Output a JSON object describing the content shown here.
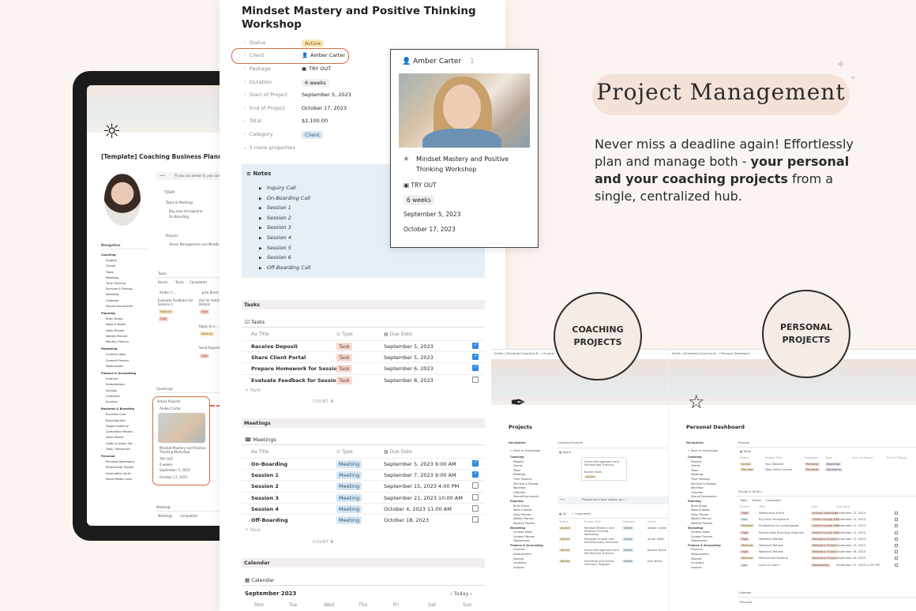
{
  "hero": {
    "badge": "Project Management",
    "description_pre": "Never miss a deadline again! Effortlessly plan and manage both - ",
    "description_bold": "your personal and your coaching projects",
    "description_post": " from a single, centralized hub."
  },
  "circles": {
    "coaching": "COACHING\nPROJECTS",
    "personal": "PERSONAL\nPROJECTS"
  },
  "page": {
    "title": "Mindset Mastery and Positive Thinking Workshop",
    "properties": [
      {
        "label": "Status",
        "value": "Active",
        "icon": "sun-icon"
      },
      {
        "label": "Client",
        "value": "Amber Carter",
        "icon": "user-icon"
      },
      {
        "label": "Package",
        "value": "TRY OUT",
        "icon": "package-icon"
      },
      {
        "label": "Duration",
        "value": "6 weeks",
        "icon": "clock-icon"
      },
      {
        "label": "Start of Project",
        "value": "September 5, 2023",
        "icon": "calendar-icon"
      },
      {
        "label": "End of Project",
        "value": "October 17, 2023",
        "icon": "calendar-icon"
      },
      {
        "label": "Total",
        "value": "$2,100.00",
        "icon": "sum-icon"
      },
      {
        "label": "Category",
        "value": "Client",
        "icon": "tag-icon"
      }
    ],
    "more_properties": "5 more properties",
    "notes": {
      "title": "Notes",
      "items": [
        "Inquiry Call",
        "On-Boarding Call",
        "Session 1",
        "Session 2",
        "Session 3",
        "Session 4",
        "Session 5",
        "Session 6",
        "Off-Boarding Call"
      ]
    },
    "tasks": {
      "section": "Tasks",
      "db_title": "Tasks",
      "headers": [
        "Aa Title",
        "Type",
        "Due Date"
      ],
      "rows": [
        {
          "title": "Receive Deposit",
          "type": "Task",
          "date": "September 5, 2023",
          "done": true
        },
        {
          "title": "Share Client Portal",
          "type": "Task",
          "date": "September 5, 2023",
          "done": true
        },
        {
          "title": "Prepare Homework for Session 1",
          "type": "Task",
          "date": "September 6, 2023",
          "done": true
        },
        {
          "title": "Evaluate Feedback for Session 1",
          "type": "Task",
          "date": "September 8, 2023",
          "done": false
        }
      ],
      "new_label": "+ New",
      "count_label": "COUNT",
      "count": "4"
    },
    "meetings": {
      "section": "Meetings",
      "db_title": "Meetings",
      "headers": [
        "Aa Title",
        "Type",
        "Due Date"
      ],
      "rows": [
        {
          "title": "On-Boarding",
          "type": "Meeting",
          "date": "September 5, 2023 9:00 AM",
          "done": true
        },
        {
          "title": "Session 1",
          "type": "Meeting",
          "date": "September 7, 2023 9:00 AM",
          "done": true
        },
        {
          "title": "Session 2",
          "type": "Meeting",
          "date": "September 15, 2023 4:00 PM",
          "done": false
        },
        {
          "title": "Session 3",
          "type": "Meeting",
          "date": "September 21, 2023 10:00 AM",
          "done": false
        },
        {
          "title": "Session 4",
          "type": "Meeting",
          "date": "October 4, 2023 11:00 AM",
          "done": false
        },
        {
          "title": "Off-Boarding",
          "type": "Meeting",
          "date": "October 18, 2023",
          "done": false
        }
      ],
      "new_label": "+ New",
      "count_label": "COUNT",
      "count": "6"
    },
    "calendar": {
      "section": "Calendar",
      "db_title": "Calendar",
      "month": "September 2023",
      "today": "Today",
      "days": [
        "Mon",
        "Tue",
        "Wed",
        "Thu",
        "Fri",
        "Sat",
        "Sun"
      ]
    }
  },
  "popup": {
    "name": "Amber Carter",
    "count": "1",
    "project": "Mindset Mastery and Positive Thinking Workshop",
    "package": "TRY OUT",
    "duration": "6 weeks",
    "start": "September 5, 2023",
    "end": "October 17, 2023"
  },
  "tablet": {
    "title": "[Template] Coaching Business Planner",
    "quote": "\"If you can dream it, you can...",
    "today": "TODAY",
    "tasks_meetings": "Tasks & Meetings",
    "todo1": "Buy new microphone",
    "todo2": "On-Boarding",
    "projects": "Projects",
    "project1": "Stress Management and Mindfu...",
    "nav_title": "Navigation",
    "nav": [
      "Coaching",
      "Projects",
      "Clients",
      "Tasks",
      "Meetings",
      "Time Tracking",
      "Services & Packag...",
      "Workflow",
      "Calendar",
      "Shared Documents",
      "Planning",
      "Brain Dump",
      "Ideas & Notes",
      "Daily Planner",
      "Weekly Planner",
      "Monthly Planner",
      "Marketing",
      "Content Ideas",
      "Content Planner",
      "Testimonials",
      "Finance & Accounting",
      "Finances",
      "Subscriptions",
      "Savings",
      "Contracts",
      "Invoices",
      "Business & Branding",
      "Business Core",
      "Branding Hub",
      "Target Audience",
      "Competitor Resear...",
      "Vision Board",
      "Goals & Action Ste...",
      "Tools / Resources",
      "Personal",
      "Personal Dashboard",
      "Productivity Tracker",
      "Information Vault",
      "Social Media Links"
    ],
    "tasks_label": "Tasks",
    "tabs": [
      "Board",
      "Tasks",
      "Completed"
    ],
    "task_cards": [
      "Amber C...",
      "Julia Brent"
    ],
    "card_text1": "Evaluate Feedback for Session 1",
    "card_text2": "Ask for testimonial Details",
    "badge_medium": "Medium",
    "badge_high": "High",
    "reply": "Reply to e...",
    "send": "Send Deposit L...",
    "coachings": "Coachings",
    "active_projects": "Active Projects",
    "card_name": "Amber Carter",
    "card_project": "Mindset Mastery and Positive Thinking Workshop",
    "card_package": "TRY OUT",
    "card_weeks": "6 weeks",
    "card_start": "September 5, 2023",
    "card_end": "October 17, 2023",
    "meetings_label": "Meetings",
    "meetings_tab": "Meetings",
    "completed_tab": "Completed"
  },
  "coaching_screen": {
    "breadcrumb": "Drafts / [Template] Coaching B... / Projects",
    "title": "Projects",
    "nav_title": "Navigation",
    "back": "Back to Homepage",
    "section": "Coaching Projects",
    "board_tab": "Board",
    "quote": "\"People don't lack values, we...\"",
    "all_tab": "All",
    "completed_tab": "Completed",
    "headers": [
      "Status",
      "Project Title",
      "Category",
      "Client"
    ],
    "rows": [
      {
        "status": "Active",
        "title": "Mindset Mastery and Positive Thinking Workshop",
        "category": "Client",
        "client": "Amber Carter"
      },
      {
        "status": "Active",
        "title": "Personal Growth and Self-Discovery Intensive",
        "category": "Client",
        "client": "Sarah Miller"
      },
      {
        "status": "Active",
        "title": "Stress Management and Mindfulness Training",
        "category": "Client",
        "client": "Bonnie Davis"
      },
      {
        "status": "Active",
        "title": "Parenting and Family Harmony Program",
        "category": "Client",
        "client": "Julia Brent"
      }
    ],
    "cards": [
      "Stress Management and Mindfulness Training",
      "Bonnie Dam",
      "Active"
    ],
    "nav": [
      "Coaching",
      "Projects",
      "Clients",
      "Tasks",
      "Meetings",
      "Time Tracking",
      "Services & Packag...",
      "Workflow",
      "Calendar",
      "Shared Documents",
      "Planning",
      "Brain Dump",
      "Ideas & Notes",
      "Daily Planner",
      "Weekly Planner",
      "Monthly Planner",
      "Marketing",
      "Content Ideas",
      "Content Planner",
      "Testimonials",
      "Finance & Accounting",
      "Finances",
      "Subscriptions",
      "Savings",
      "Contracts",
      "Invoices"
    ]
  },
  "personal_screen": {
    "breadcrumb": "Drafts / [Template] Coaching B... / Personal Dashboard",
    "title": "Personal Dashboard",
    "nav_title": "Navigation",
    "back": "Back to Homepage",
    "projects": "Projects",
    "table_tab": "Table",
    "proj_headers": [
      "Status",
      "Project Title",
      "Category",
      "Type",
      "Start of Project",
      "End of Project"
    ],
    "proj_rows": [
      {
        "status": "Active",
        "title": "Your Website",
        "category": "Personal",
        "type": "Branding"
      },
      {
        "status": "Planned",
        "title": "New Online Course",
        "category": "Personal",
        "type": "Marketing"
      }
    ],
    "events": "Events & To-Do's",
    "events_tabs": [
      "Table",
      "Board",
      "Completed"
    ],
    "ev_headers": [
      "Priority",
      "Title",
      "Type",
      "Due Date"
    ],
    "ev_rows": [
      {
        "priority": "High",
        "title": "Networking Event",
        "type": "Annual Coaching",
        "date": "September 11, 2023"
      },
      {
        "priority": "Low",
        "title": "Buy new microphone",
        "type": "Online Course #1",
        "date": "September 11, 2023"
      },
      {
        "priority": "Medium",
        "title": "Photoshoot for Landingpage",
        "type": "Online Course #1",
        "date": "September 11, 2023"
      },
      {
        "priority": "High",
        "title": "Review New Branding Materials",
        "type": "Online Course #1",
        "date": "September 11, 2023"
      },
      {
        "priority": "High",
        "title": "Weekend Retreat",
        "type": "Retreat in Tulum",
        "date": "September 13, 2023"
      },
      {
        "priority": "Medium",
        "title": "Weekend Retreat",
        "type": "Retreat in Tulum",
        "date": "September 15, 2023"
      },
      {
        "priority": "High",
        "title": "Weekend Retreat",
        "type": "Retreat in Tulum",
        "date": "September 16, 2023"
      },
      {
        "priority": "Medium",
        "title": "Mastermind Meeting",
        "type": "Retreat in Tulum",
        "date": "September 16, 2023"
      },
      {
        "priority": "Low",
        "title": "Lunch & Learn",
        "type": "Networking",
        "date": "September 17, 2023 12:00 PM"
      }
    ],
    "calendar": "Calendar",
    "personal_tab": "Personal",
    "nav": [
      "Coaching",
      "Projects",
      "Clients",
      "Tasks",
      "Meetings",
      "Time Tracking",
      "Services & Packag...",
      "Workflow",
      "Calendar",
      "Shared Documents",
      "Planning",
      "Brain Dump",
      "Ideas & Notes",
      "Daily Planner",
      "Weekly Planner",
      "Monthly Planner",
      "Marketing",
      "Content Ideas",
      "Content Planner",
      "Testimonials",
      "Finance & Accounting",
      "Finances",
      "Subscriptions",
      "Savings",
      "Contracts",
      "Invoices"
    ]
  },
  "colors": {
    "accent": "#d36b45",
    "notes_bg": "#e5eff5",
    "pill_bg": "#f4e2d9",
    "check": "#2f8ae0"
  }
}
